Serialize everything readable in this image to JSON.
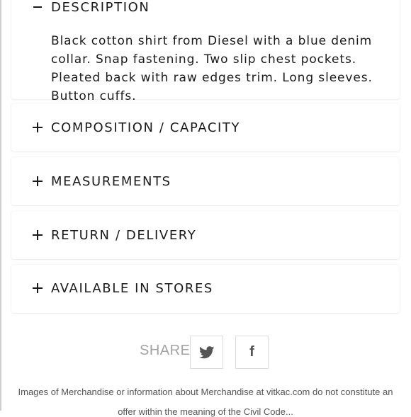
{
  "accordion": {
    "description": {
      "title": "DESCRIPTION",
      "body": "Black cotton shirt from Diesel with a blue denim collar. Snap fastening. Two slip chest pockets. Pleated back with raw edges trim. Long sleeves. Button cuffs."
    },
    "composition": {
      "title": "COMPOSITION / CAPACITY"
    },
    "measurements": {
      "title": "MEASUREMENTS"
    },
    "return_delivery": {
      "title": "RETURN / DELIVERY"
    },
    "stores": {
      "title": "AVAILABLE IN STORES"
    }
  },
  "share": {
    "label": "SHARE",
    "twitter_icon": "twitter-bird-icon",
    "facebook_glyph": "f"
  },
  "footer": {
    "disclaimer": "Images of Merchandise or information about Merchandise at vitkac.com do not constitute an",
    "disclaimer_cont": "offer within the meaning of the Civil Code..."
  },
  "colors": {
    "text": "#1a1a1a",
    "muted": "#a3a3a3",
    "border": "#dcdcdc"
  }
}
